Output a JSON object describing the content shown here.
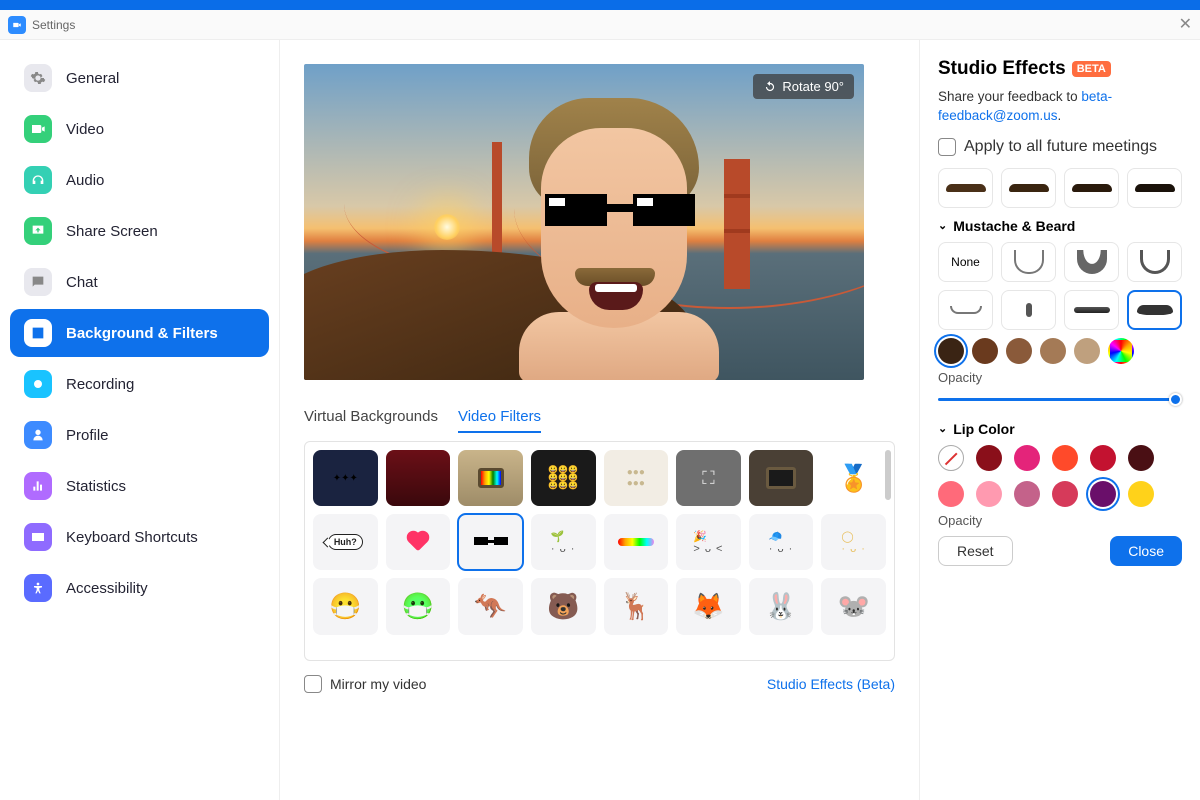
{
  "titlebar": {
    "title": "Settings"
  },
  "sidebar": {
    "items": [
      {
        "id": "general",
        "label": "General",
        "color": "#e8e8ee",
        "active": false
      },
      {
        "id": "video",
        "label": "Video",
        "color": "#34d07a",
        "active": false
      },
      {
        "id": "audio",
        "label": "Audio",
        "color": "#34d0b4",
        "active": false
      },
      {
        "id": "share-screen",
        "label": "Share Screen",
        "color": "#34d07a",
        "active": false
      },
      {
        "id": "chat",
        "label": "Chat",
        "color": "#e8e8ee",
        "active": false
      },
      {
        "id": "background-filters",
        "label": "Background & Filters",
        "color": "#0E71EB",
        "active": true
      },
      {
        "id": "recording",
        "label": "Recording",
        "color": "#19c3ff",
        "active": false
      },
      {
        "id": "profile",
        "label": "Profile",
        "color": "#3d8bff",
        "active": false
      },
      {
        "id": "statistics",
        "label": "Statistics",
        "color": "#b06bff",
        "active": false
      },
      {
        "id": "keyboard-shortcuts",
        "label": "Keyboard Shortcuts",
        "color": "#8f6bff",
        "active": false
      },
      {
        "id": "accessibility",
        "label": "Accessibility",
        "color": "#5a6bff",
        "active": false
      }
    ]
  },
  "preview": {
    "rotate_label": "Rotate 90°"
  },
  "tabs": {
    "virtual_backgrounds": "Virtual Backgrounds",
    "video_filters": "Video Filters",
    "active": "video_filters"
  },
  "filters": {
    "huh_text": "Huh?",
    "items": [
      "lights",
      "curtain",
      "tv",
      "emoji-grid",
      "balls",
      "crop",
      "crt",
      "award",
      "huh",
      "heart",
      "glasses",
      "sprout",
      "rainbow",
      "party",
      "cap",
      "halo",
      "mask-white",
      "mask-green",
      "kangaroo",
      "deer",
      "reindeer",
      "fox",
      "bunny",
      "mouse"
    ],
    "selected": "glasses"
  },
  "bottom": {
    "mirror_label": "Mirror my video",
    "studio_link": "Studio Effects (Beta)"
  },
  "studio": {
    "title": "Studio Effects",
    "beta": "BETA",
    "feedback_pre": "Share your feedback to ",
    "feedback_link": "beta-feedback@zoom.us",
    "feedback_post": ".",
    "apply_all": "Apply to all future meetings",
    "eyebrows": {
      "colors": [
        "#4a3018",
        "#3a2510",
        "#2a1a0c",
        "#1a120a"
      ]
    },
    "mustache": {
      "title": "Mustache & Beard",
      "none_label": "None",
      "selected_index": 7,
      "colors": [
        "#3a2414",
        "#6a3a1e",
        "#8a5a3a",
        "#a47a56",
        "#bfa07e"
      ],
      "selected_color": 0,
      "opacity_label": "Opacity",
      "opacity_value": 100
    },
    "lip": {
      "title": "Lip Color",
      "colors_row1": [
        "none",
        "#8a0f1a",
        "#e4247a",
        "#ff4a2a",
        "#c31230",
        "#4a0f14"
      ],
      "colors_row2": [
        "#ff6a7a",
        "#ff9ab0",
        "#c4628a",
        "#d63a5a",
        "#6a0f6a",
        "#ffd21a"
      ],
      "selected": "r2c5",
      "opacity_label": "Opacity"
    },
    "reset": "Reset",
    "close": "Close"
  }
}
